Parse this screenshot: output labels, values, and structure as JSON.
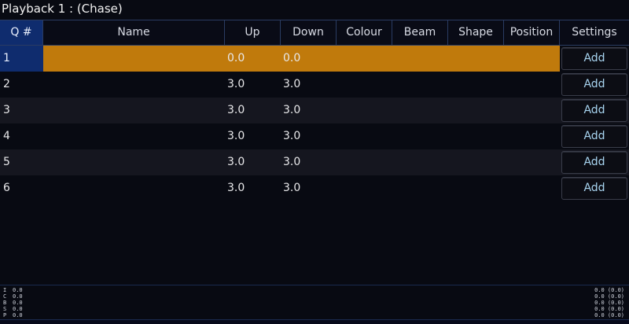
{
  "title": "Playback 1 :  (Chase)",
  "columns": {
    "q": "Q #",
    "name": "Name",
    "up": "Up",
    "down": "Down",
    "colour": "Colour",
    "beam": "Beam",
    "shape": "Shape",
    "position": "Position",
    "settings": "Settings"
  },
  "rows": [
    {
      "q": "1",
      "name": "",
      "up": "0.0",
      "down": "0.0",
      "settings": "Add"
    },
    {
      "q": "2",
      "name": "",
      "up": "3.0",
      "down": "3.0",
      "settings": "Add"
    },
    {
      "q": "3",
      "name": "",
      "up": "3.0",
      "down": "3.0",
      "settings": "Add"
    },
    {
      "q": "4",
      "name": "",
      "up": "3.0",
      "down": "3.0",
      "settings": "Add"
    },
    {
      "q": "5",
      "name": "",
      "up": "3.0",
      "down": "3.0",
      "settings": "Add"
    },
    {
      "q": "6",
      "name": "",
      "up": "3.0",
      "down": "3.0",
      "settings": "Add"
    }
  ],
  "footer": {
    "left": [
      {
        "label": "I",
        "value": "0.0"
      },
      {
        "label": "C",
        "value": "0.0"
      },
      {
        "label": "B",
        "value": "0.0"
      },
      {
        "label": "S",
        "value": "0.0"
      },
      {
        "label": "P",
        "value": "0.0"
      }
    ],
    "right": [
      "0.0 (0.0)",
      "0.0 (0.0)",
      "0.0 (0.0)",
      "0.0 (0.0)",
      "0.0 (0.0)"
    ]
  },
  "colors": {
    "active_row": "#c07a0c",
    "selected_q": "#0f2c6e",
    "add_text": "#a8d4f0"
  }
}
